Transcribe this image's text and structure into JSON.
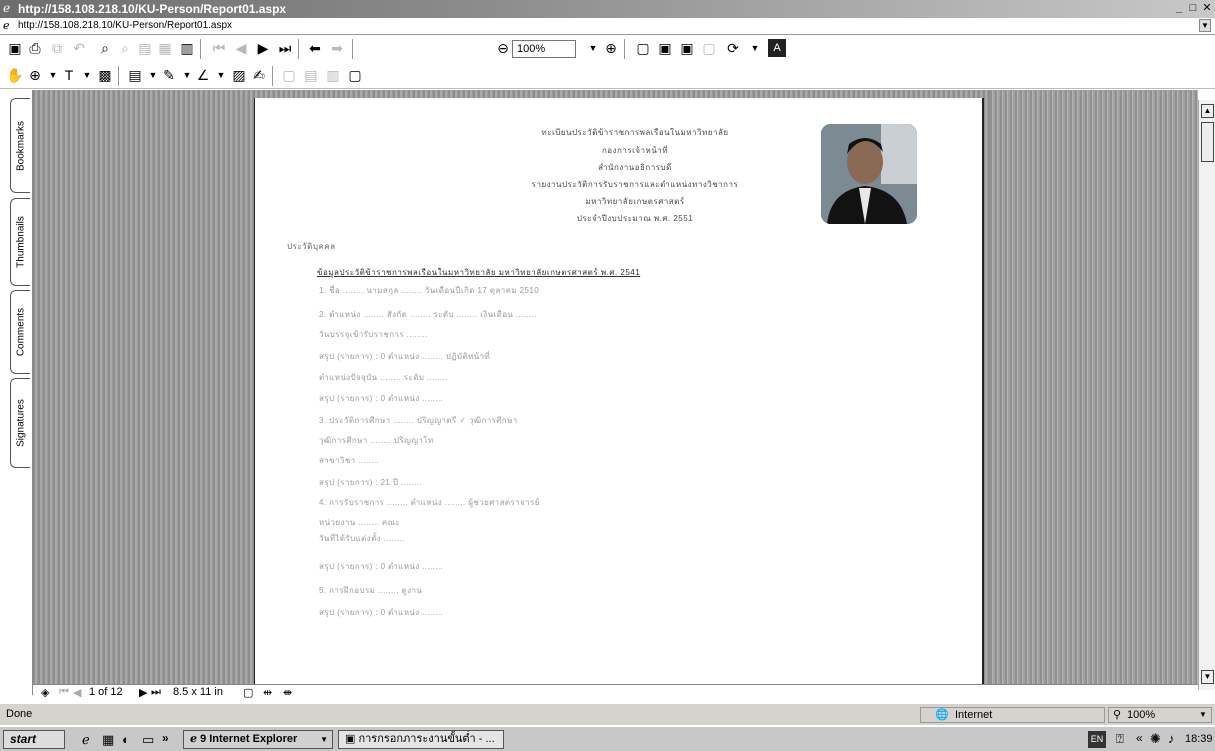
{
  "window": {
    "title": "http://158.108.218.10/KU-Person/Report01.aspx"
  },
  "address": {
    "url": "http://158.108.218.10/KU-Person/Report01.aspx"
  },
  "toolbar": {
    "zoom_value": "100%"
  },
  "side_tabs": [
    "Bookmarks",
    "Thumbnails",
    "Comments",
    "Signatures"
  ],
  "document": {
    "header_lines": [
      "ทะเบียนประวัติข้าราชการพลเรือนในมหาวิทยาลัย",
      "กองการเจ้าหน้าที่",
      "สำนักงานอธิการบดี",
      "รายงานประวัติการรับราชการและตำแหน่งทางวิชาการ",
      "มหาวิทยาลัยเกษตรศาสตร์",
      "ประจำปีงบประมาณ พ.ศ. 2551"
    ],
    "section_label": "ประวัติบุคคล",
    "section_title": "ข้อมูลประวัติข้าราชการพลเรือนในมหาวิทยาลัย มหาวิทยาลัยเกษตรศาสตร์ พ.ศ. 2541",
    "body_lines": [
      "1. ชื่อ ........ นามสกุล ........ วันเดือนปีเกิด 17 ตุลาคม 2510",
      "2. ตำแหน่ง ........ สังกัด ........ ระดับ ........ เงินเดือน ........",
      "   วันบรรจุเข้ารับราชการ ........",
      "   สรุป (รายการ) : 0 ตำแหน่ง ........ ปฏิบัติหน้าที่",
      "   ตำแหน่งปัจจุบัน ........ ระดับ ........",
      "   สรุป (รายการ) : 0 ตำแหน่ง ........",
      "3. ประวัติการศึกษา ........ ปริญญาตรี ✓ วุฒิการศึกษา",
      "   วุฒิการศึกษา ........ ปริญญาโท",
      "   สาขาวิชา ........",
      "   สรุป (รายการ) : 21 ปี ........",
      "4. การรับราชการ ........ ตำแหน่ง ........ ผู้ช่วยศาสตราจารย์",
      "   หน่วยงาน ........ คณะ",
      "   วันที่ได้รับแต่งตั้ง ........",
      "   สรุป (รายการ) : 0 ตำแหน่ง ........",
      "5. การฝึกอบรม ........ ดูงาน",
      "   สรุป (รายการ) : 0 ตำแหน่ง ........"
    ]
  },
  "navbar": {
    "page_info": "1 of 12",
    "page_size": "8.5 x 11 in"
  },
  "status": {
    "text": "Done",
    "zone": "Internet",
    "zoom": "100%"
  },
  "taskbar": {
    "start": "start",
    "tasks": [
      "9 Internet Explorer",
      "การกรอกภาระงานขั้นต่ำ - ..."
    ],
    "lang": "EN",
    "clock": "18:39"
  }
}
